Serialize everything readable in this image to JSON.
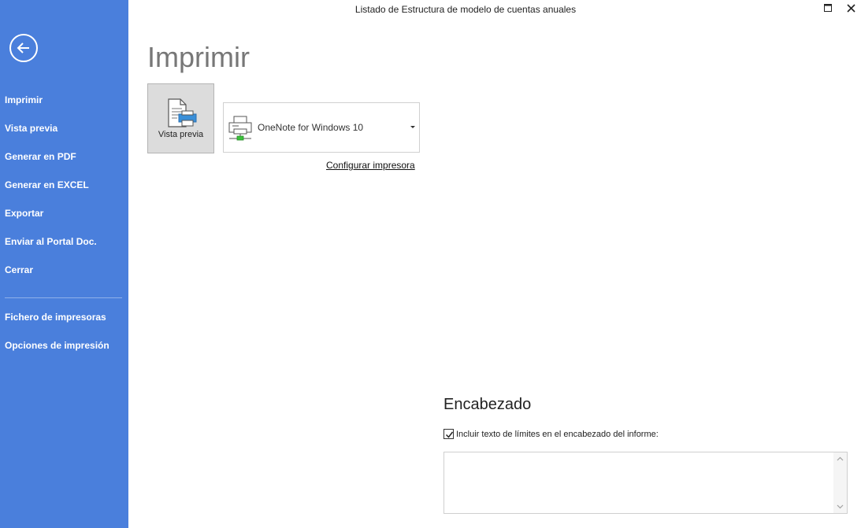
{
  "window": {
    "title": "Listado de Estructura de modelo de cuentas anuales"
  },
  "sidebar": {
    "items": [
      {
        "label": "Imprimir"
      },
      {
        "label": "Vista previa"
      },
      {
        "label": "Generar en PDF"
      },
      {
        "label": "Generar en EXCEL"
      },
      {
        "label": "Exportar"
      },
      {
        "label": "Enviar al Portal Doc."
      },
      {
        "label": "Cerrar"
      }
    ],
    "secondary_items": [
      {
        "label": "Fichero de impresoras"
      },
      {
        "label": "Opciones de impresión"
      }
    ]
  },
  "main": {
    "title": "Imprimir",
    "preview_button_label": "Vista previa",
    "printer": {
      "selected": "OneNote for Windows 10"
    },
    "config_link": "Configurar impresora",
    "header_section": {
      "title": "Encabezado",
      "checkbox_label": "Incluir texto de límites en el encabezado del informe:",
      "checkbox_checked": true,
      "text_value": ""
    }
  },
  "colors": {
    "sidebar_bg": "#4a7fdc",
    "sidebar_text": "#ffffff",
    "title_gray": "#777777"
  },
  "icons": {
    "back": "arrow-left-circle-icon",
    "preview": "document-preview-icon",
    "printer": "printer-icon",
    "maximize": "maximize-icon",
    "close": "close-icon"
  }
}
